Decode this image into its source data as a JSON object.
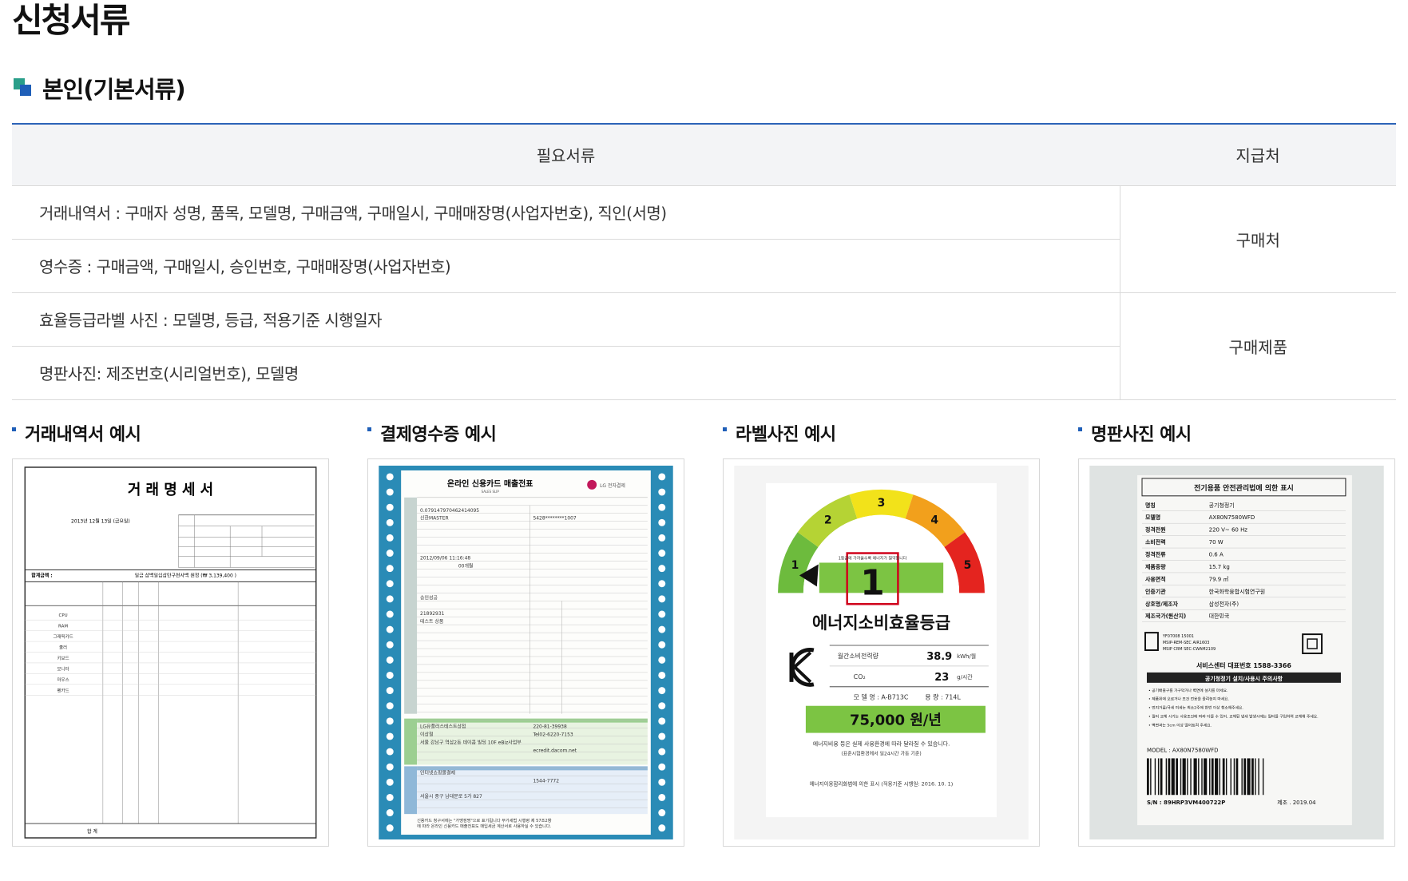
{
  "page_title": "신청서류",
  "section_title": "본인(기본서류)",
  "table": {
    "headers": [
      "필요서류",
      "지급처"
    ],
    "rows": [
      "거래내역서 : 구매자 성명, 품목, 모델명, 구매금액, 구매일시, 구매매장명(사업자번호), 직인(서명)",
      "영수증 : 구매금액, 구매일시, 승인번호, 구매매장명(사업자번호)",
      "효율등급라벨 사진 : 모델명, 등급, 적용기준 시행일자",
      "명판사진: 제조번호(시리얼번호), 모델명"
    ],
    "sources": [
      "구매처",
      "구매제품"
    ]
  },
  "examples": [
    {
      "title": "거래내역서 예시"
    },
    {
      "title": "결제영수증 예시"
    },
    {
      "title": "라벨사진 예시"
    },
    {
      "title": "명판사진 예시"
    }
  ],
  "invoice": {
    "title": "거 래 명 세 서",
    "date": "2013년 12월 13일 (금요일)",
    "total_label": "합계금액 :",
    "total_value": "일금 삼백일십삼만구천사백 원정 (₩ 3,139,400 )",
    "items": [
      "CPU",
      "RAM",
      "그래픽카드",
      "쿨러",
      "키보드",
      "모니터",
      "마우스",
      "펜카드"
    ],
    "sum_label": "합 계"
  },
  "receipt": {
    "title": "온라인 신용카드 매출전표",
    "subtitle": "SALES SLIP",
    "badge": "LG 전자결제",
    "fields": [
      "0.079147970462414095",
      "신한MASTER",
      "5428********1007",
      "2012/09/06 11:16:48",
      "00개월",
      "승인성공",
      "21892931",
      "테스트 상품",
      "LG유플러스테스트상점",
      "220-81-39938",
      "이상철",
      "Tel02-6220-7153",
      "서울 강남구 역삼2동 데이콤 빌딩 10F eBiz사업부",
      "ecredit.dacom.net",
      "인터넷쇼핑몰결제",
      "1544-7772",
      "서울시 중구 남대문로 5가 827"
    ],
    "footer": "신용카드 청구서에는 \"가맹점명\"으로 표기됩니다 부가세법 시행령 제 57조2항에 따라 온라인 신용카드 매출전표도 매입세금 계산서로 사용하실 수 있습니다."
  },
  "label": {
    "grade": "1",
    "scale": [
      "1",
      "2",
      "3",
      "4",
      "5"
    ],
    "grade_text": "1등급에 가까울수록 에너지가 절약됩니다",
    "title": "에너지소비효율등급",
    "monthly_label": "월간소비전력량",
    "monthly_value": "38.9",
    "monthly_unit": "kWh/월",
    "co2_label": "CO₂",
    "co2_value": "23",
    "co2_unit": "g/시간",
    "model": "모 델 명 : A-B713C",
    "capacity": "용 량 : 714L",
    "annual_cost": "75,000 원/년",
    "note1": "에너지비용 등은 실제 사용환경에 따라 달라질 수 있습니다.",
    "note2": "(표준시험환경에서 일24시간 가동 기준)",
    "footer": "에너지이용합리화법에 의한 표시 (적용기준 시행일: 2016. 10. 1)"
  },
  "nameplate": {
    "title": "전기용품 안전관리법에 의한 표시",
    "rows": [
      [
        "명칭",
        "공기청정기"
      ],
      [
        "모델명",
        "AX80N7580WFD"
      ],
      [
        "정격전원",
        "220 V~ 60 Hz"
      ],
      [
        "소비전력",
        "70 W"
      ],
      [
        "정격전류",
        "0.6 A"
      ],
      [
        "제품중량",
        "15.7 kg"
      ],
      [
        "사용면적",
        "79.9 ㎡"
      ],
      [
        "인증기관",
        "한국화학융합시험연구원"
      ],
      [
        "상호명/제조자",
        "삼성전자(주)"
      ],
      [
        "제조국가(원산지)",
        "대한민국"
      ]
    ],
    "cert": [
      "YF07008 15001",
      "MSIP-REM-SEC AIR1603",
      "MSIP CRM SEC-CWAM2109"
    ],
    "service": "서비스센터 대표번호 1588-3366",
    "warning_title": "공기청정기 설치/사용시 주의사항",
    "warnings": [
      "• 공기배출구를 가구막거나 벽면에 설치를 마세요.",
      "• 제품위에 오르거나 모건 전용을 올려놓지 마세요.",
      "• 먼지거름/극세 미세는 최소2주에 한번 이상 청소해주세요.",
      "• 필터 교체 시기는 사용조건에 따라 다를 수 있어, 교체된 냄새 발생시에는 필터를 구입하여 교체해 주세요.",
      "• 벽면과는 5cm 이상 떨어트려 주세요."
    ],
    "model_line": "MODEL : AX80N7580WFD",
    "serial": "S/N : 89HRP3VM400722P",
    "made": "제조 . 2019.04"
  }
}
